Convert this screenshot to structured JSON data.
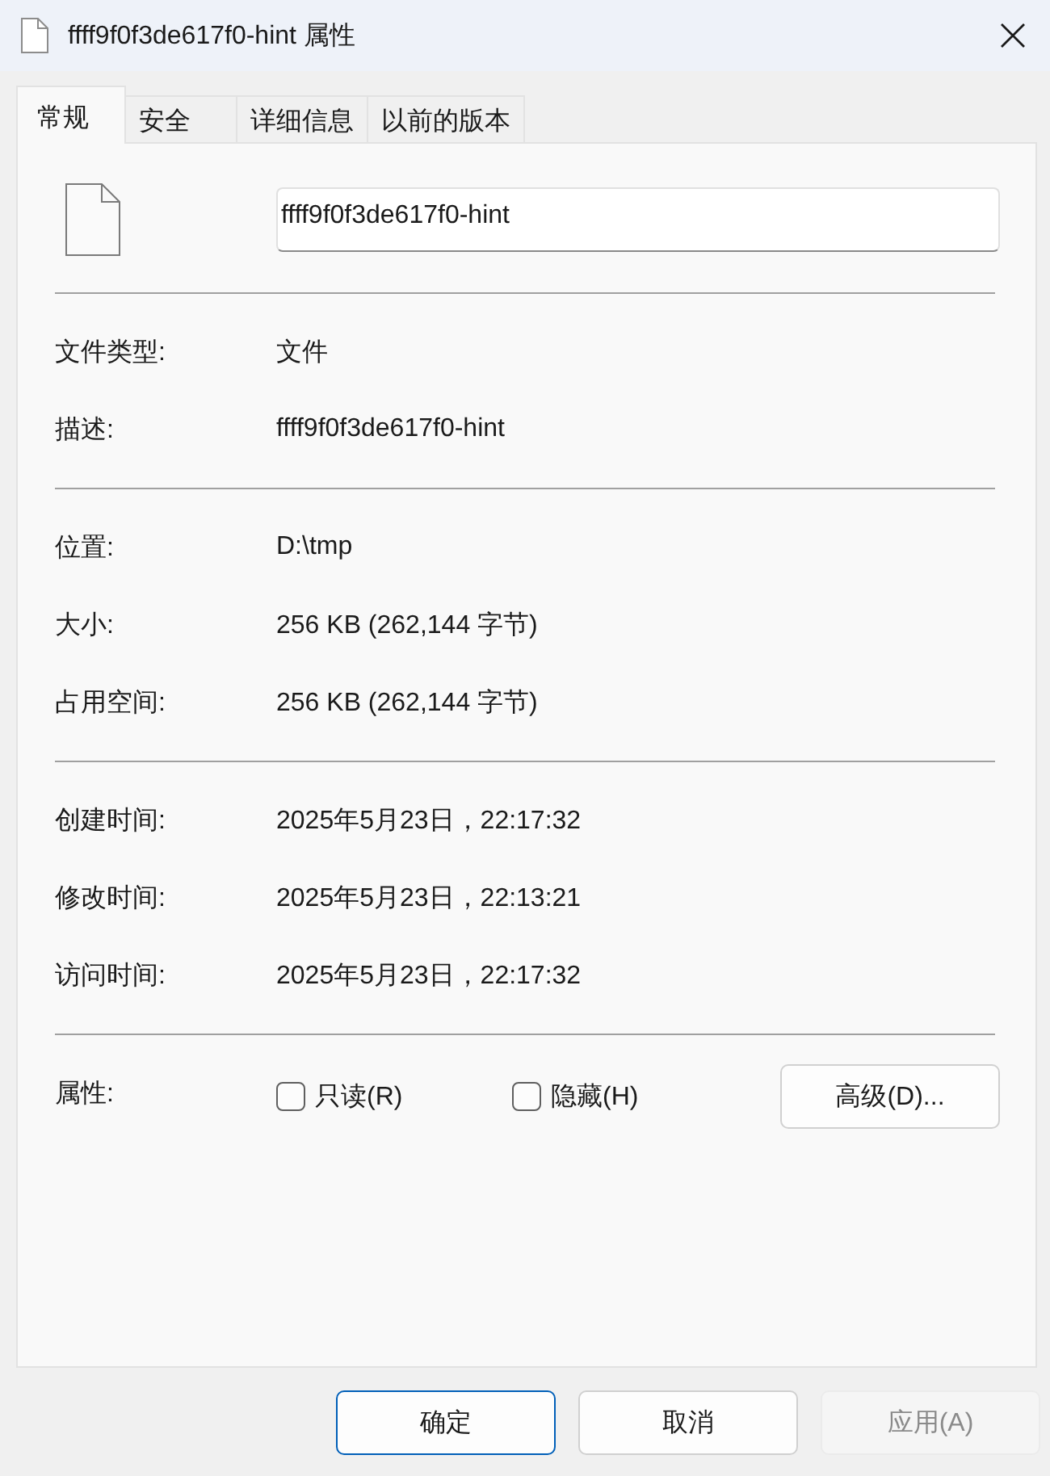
{
  "window": {
    "title": "ffff9f0f3de617f0-hint 属性"
  },
  "tabs": [
    {
      "label": "常规",
      "selected": true
    },
    {
      "label": "安全",
      "selected": false
    },
    {
      "label": "详细信息",
      "selected": false
    },
    {
      "label": "以前的版本",
      "selected": false
    }
  ],
  "name_field": {
    "value": "ffff9f0f3de617f0-hint"
  },
  "sections": [
    [
      {
        "label": "文件类型:",
        "value": "文件"
      },
      {
        "label": "描述:",
        "value": "ffff9f0f3de617f0-hint"
      }
    ],
    [
      {
        "label": "位置:",
        "value": "D:\\tmp"
      },
      {
        "label": "大小:",
        "value": "256 KB (262,144 字节)"
      },
      {
        "label": "占用空间:",
        "value": "256 KB (262,144 字节)"
      }
    ],
    [
      {
        "label": "创建时间:",
        "value": "2025年5月23日，22:17:32"
      },
      {
        "label": "修改时间:",
        "value": "2025年5月23日，22:13:21"
      },
      {
        "label": "访问时间:",
        "value": "2025年5月23日，22:17:32"
      }
    ]
  ],
  "attributes": {
    "label": "属性:",
    "checkboxes": [
      {
        "label": "只读(R)",
        "checked": false
      },
      {
        "label": "隐藏(H)",
        "checked": false
      }
    ],
    "advanced_button": "高级(D)..."
  },
  "buttons": [
    {
      "label": "确定",
      "default": true,
      "disabled": false
    },
    {
      "label": "取消",
      "default": false,
      "disabled": false
    },
    {
      "label": "应用(A)",
      "default": false,
      "disabled": true
    }
  ]
}
